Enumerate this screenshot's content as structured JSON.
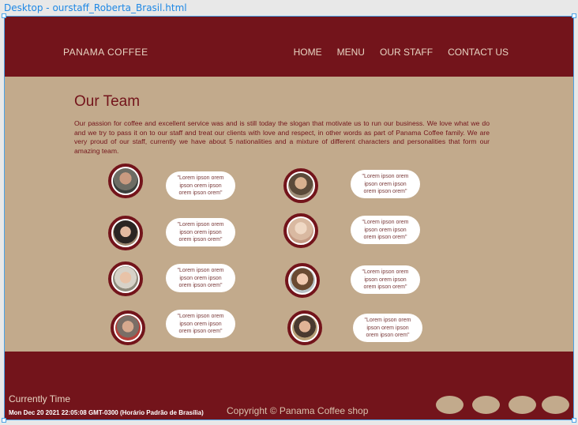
{
  "editor_tab": "Desktop - ourstaff_Roberta_Brasil.html",
  "header": {
    "brand": "PANAMA  COFFEE",
    "nav": [
      "HOME",
      "MENU",
      "OUR STAFF",
      "CONTACT US"
    ]
  },
  "main": {
    "title": "Our Team",
    "intro": "Our passion for coffee and excellent service was and is still today the slogan that motivate us to run our business. We love what we do and we try to pass it on to our staff and treat our clients with love and respect, in other words as part of Panama Coffee family. We are very proud of our staff, currently we have about 5 nationalities and a mixture of different characters and personalities that form our amazing team.",
    "staff_quote": "\"Lorem ipson orem ipson orem ipson orem ipson orem\""
  },
  "footer": {
    "current_time_label": "Currently Time",
    "current_time_value": "Mon Dec 20 2021 22:05:08 GMT-0300 (Horário Padrão de Brasília)",
    "copyright": "Copyright © Panama Coffee shop"
  },
  "colors": {
    "maroon": "#73141b",
    "tan": "#c2aa8c",
    "cream": "#e7d3c1"
  }
}
